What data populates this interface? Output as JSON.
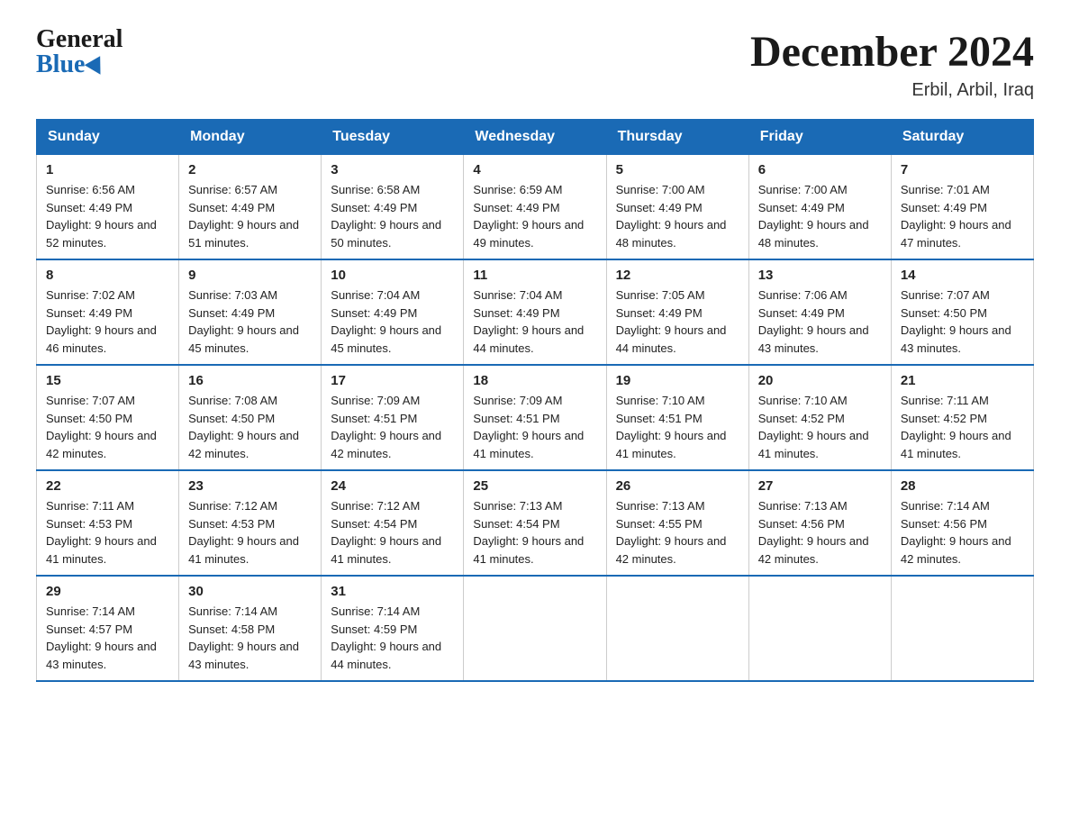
{
  "header": {
    "logo_general": "General",
    "logo_blue": "Blue",
    "title": "December 2024",
    "subtitle": "Erbil, Arbil, Iraq"
  },
  "days_of_week": [
    "Sunday",
    "Monday",
    "Tuesday",
    "Wednesday",
    "Thursday",
    "Friday",
    "Saturday"
  ],
  "weeks": [
    [
      {
        "day": "1",
        "sunrise": "Sunrise: 6:56 AM",
        "sunset": "Sunset: 4:49 PM",
        "daylight": "Daylight: 9 hours and 52 minutes."
      },
      {
        "day": "2",
        "sunrise": "Sunrise: 6:57 AM",
        "sunset": "Sunset: 4:49 PM",
        "daylight": "Daylight: 9 hours and 51 minutes."
      },
      {
        "day": "3",
        "sunrise": "Sunrise: 6:58 AM",
        "sunset": "Sunset: 4:49 PM",
        "daylight": "Daylight: 9 hours and 50 minutes."
      },
      {
        "day": "4",
        "sunrise": "Sunrise: 6:59 AM",
        "sunset": "Sunset: 4:49 PM",
        "daylight": "Daylight: 9 hours and 49 minutes."
      },
      {
        "day": "5",
        "sunrise": "Sunrise: 7:00 AM",
        "sunset": "Sunset: 4:49 PM",
        "daylight": "Daylight: 9 hours and 48 minutes."
      },
      {
        "day": "6",
        "sunrise": "Sunrise: 7:00 AM",
        "sunset": "Sunset: 4:49 PM",
        "daylight": "Daylight: 9 hours and 48 minutes."
      },
      {
        "day": "7",
        "sunrise": "Sunrise: 7:01 AM",
        "sunset": "Sunset: 4:49 PM",
        "daylight": "Daylight: 9 hours and 47 minutes."
      }
    ],
    [
      {
        "day": "8",
        "sunrise": "Sunrise: 7:02 AM",
        "sunset": "Sunset: 4:49 PM",
        "daylight": "Daylight: 9 hours and 46 minutes."
      },
      {
        "day": "9",
        "sunrise": "Sunrise: 7:03 AM",
        "sunset": "Sunset: 4:49 PM",
        "daylight": "Daylight: 9 hours and 45 minutes."
      },
      {
        "day": "10",
        "sunrise": "Sunrise: 7:04 AM",
        "sunset": "Sunset: 4:49 PM",
        "daylight": "Daylight: 9 hours and 45 minutes."
      },
      {
        "day": "11",
        "sunrise": "Sunrise: 7:04 AM",
        "sunset": "Sunset: 4:49 PM",
        "daylight": "Daylight: 9 hours and 44 minutes."
      },
      {
        "day": "12",
        "sunrise": "Sunrise: 7:05 AM",
        "sunset": "Sunset: 4:49 PM",
        "daylight": "Daylight: 9 hours and 44 minutes."
      },
      {
        "day": "13",
        "sunrise": "Sunrise: 7:06 AM",
        "sunset": "Sunset: 4:49 PM",
        "daylight": "Daylight: 9 hours and 43 minutes."
      },
      {
        "day": "14",
        "sunrise": "Sunrise: 7:07 AM",
        "sunset": "Sunset: 4:50 PM",
        "daylight": "Daylight: 9 hours and 43 minutes."
      }
    ],
    [
      {
        "day": "15",
        "sunrise": "Sunrise: 7:07 AM",
        "sunset": "Sunset: 4:50 PM",
        "daylight": "Daylight: 9 hours and 42 minutes."
      },
      {
        "day": "16",
        "sunrise": "Sunrise: 7:08 AM",
        "sunset": "Sunset: 4:50 PM",
        "daylight": "Daylight: 9 hours and 42 minutes."
      },
      {
        "day": "17",
        "sunrise": "Sunrise: 7:09 AM",
        "sunset": "Sunset: 4:51 PM",
        "daylight": "Daylight: 9 hours and 42 minutes."
      },
      {
        "day": "18",
        "sunrise": "Sunrise: 7:09 AM",
        "sunset": "Sunset: 4:51 PM",
        "daylight": "Daylight: 9 hours and 41 minutes."
      },
      {
        "day": "19",
        "sunrise": "Sunrise: 7:10 AM",
        "sunset": "Sunset: 4:51 PM",
        "daylight": "Daylight: 9 hours and 41 minutes."
      },
      {
        "day": "20",
        "sunrise": "Sunrise: 7:10 AM",
        "sunset": "Sunset: 4:52 PM",
        "daylight": "Daylight: 9 hours and 41 minutes."
      },
      {
        "day": "21",
        "sunrise": "Sunrise: 7:11 AM",
        "sunset": "Sunset: 4:52 PM",
        "daylight": "Daylight: 9 hours and 41 minutes."
      }
    ],
    [
      {
        "day": "22",
        "sunrise": "Sunrise: 7:11 AM",
        "sunset": "Sunset: 4:53 PM",
        "daylight": "Daylight: 9 hours and 41 minutes."
      },
      {
        "day": "23",
        "sunrise": "Sunrise: 7:12 AM",
        "sunset": "Sunset: 4:53 PM",
        "daylight": "Daylight: 9 hours and 41 minutes."
      },
      {
        "day": "24",
        "sunrise": "Sunrise: 7:12 AM",
        "sunset": "Sunset: 4:54 PM",
        "daylight": "Daylight: 9 hours and 41 minutes."
      },
      {
        "day": "25",
        "sunrise": "Sunrise: 7:13 AM",
        "sunset": "Sunset: 4:54 PM",
        "daylight": "Daylight: 9 hours and 41 minutes."
      },
      {
        "day": "26",
        "sunrise": "Sunrise: 7:13 AM",
        "sunset": "Sunset: 4:55 PM",
        "daylight": "Daylight: 9 hours and 42 minutes."
      },
      {
        "day": "27",
        "sunrise": "Sunrise: 7:13 AM",
        "sunset": "Sunset: 4:56 PM",
        "daylight": "Daylight: 9 hours and 42 minutes."
      },
      {
        "day": "28",
        "sunrise": "Sunrise: 7:14 AM",
        "sunset": "Sunset: 4:56 PM",
        "daylight": "Daylight: 9 hours and 42 minutes."
      }
    ],
    [
      {
        "day": "29",
        "sunrise": "Sunrise: 7:14 AM",
        "sunset": "Sunset: 4:57 PM",
        "daylight": "Daylight: 9 hours and 43 minutes."
      },
      {
        "day": "30",
        "sunrise": "Sunrise: 7:14 AM",
        "sunset": "Sunset: 4:58 PM",
        "daylight": "Daylight: 9 hours and 43 minutes."
      },
      {
        "day": "31",
        "sunrise": "Sunrise: 7:14 AM",
        "sunset": "Sunset: 4:59 PM",
        "daylight": "Daylight: 9 hours and 44 minutes."
      },
      null,
      null,
      null,
      null
    ]
  ]
}
